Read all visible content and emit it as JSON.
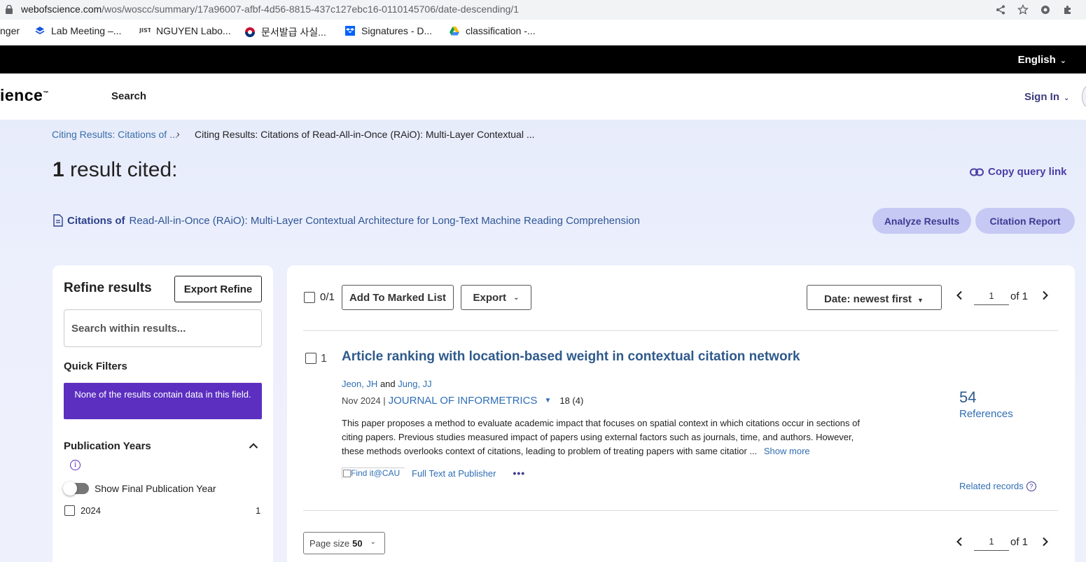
{
  "browser": {
    "url_host": "webofscience.com",
    "url_path": "/wos/woscc/summary/17a96007-afbf-4d56-8815-437c127ebc16-0110145706/date-descending/1",
    "bookmarks": [
      "nger",
      "Lab Meeting –...",
      "NGUYEN Labo...",
      "문서발급 사실...",
      "Signatures - D...",
      "classification -..."
    ]
  },
  "topbar": {
    "language": "English"
  },
  "header": {
    "logo": "ience",
    "logo_tm": "™",
    "nav_search": "Search",
    "sign_in": "Sign In"
  },
  "breadcrumb": {
    "item1": "Citing Results: Citations of ...",
    "sep": "›",
    "item2": "Citing Results: Citations of Read-All-in-Once (RAiO): Multi-Layer Contextual ..."
  },
  "summary": {
    "count": "1",
    "title_suffix": " result cited:",
    "copy_link": "Copy query link",
    "citations_label": "Citations of",
    "citations_title": "Read-All-in-Once (RAiO): Multi-Layer Contextual Architecture for Long-Text Machine Reading Comprehension",
    "analyze_btn": "Analyze Results",
    "report_btn": "Citation Report"
  },
  "refine": {
    "title": "Refine results",
    "export_btn": "Export Refine",
    "search_placeholder": "Search within results...",
    "quick_filters": "Quick Filters",
    "quick_filters_msg": "None of the results contain data in this field.",
    "pub_years": "Publication Years",
    "toggle_label": "Show Final Publication Year",
    "years": [
      {
        "label": "2024",
        "count": "1"
      }
    ]
  },
  "results": {
    "selected": "0/1",
    "add_marked": "Add To Marked List",
    "export": "Export",
    "sort": "Date: newest first",
    "page": "1",
    "of": "of 1",
    "record": {
      "num": "1",
      "title": "Article ranking with location-based weight in contextual citation network",
      "author1": "Jeon, JH",
      "and": "and",
      "author2": "Jung, JJ",
      "date": "Nov 2024 |",
      "journal": "JOURNAL OF INFORMETRICS",
      "volume": "18 (4)",
      "abstract": "This paper proposes a method to evaluate academic impact that focuses on spatial context in which citations occur in sections of citing papers. Previous studies measured impact of papers using external factors such as journals, time, and authors. However, these methods overlooks context of citations, leading to problem of treating papers with same citatior ...",
      "show_more": "Show more",
      "findit": "Find it@CAU",
      "full_text": "Full Text at Publisher",
      "refs_count": "54",
      "refs_label": "References",
      "related": "Related records"
    },
    "page_size_label": "Page size",
    "page_size": "50"
  }
}
